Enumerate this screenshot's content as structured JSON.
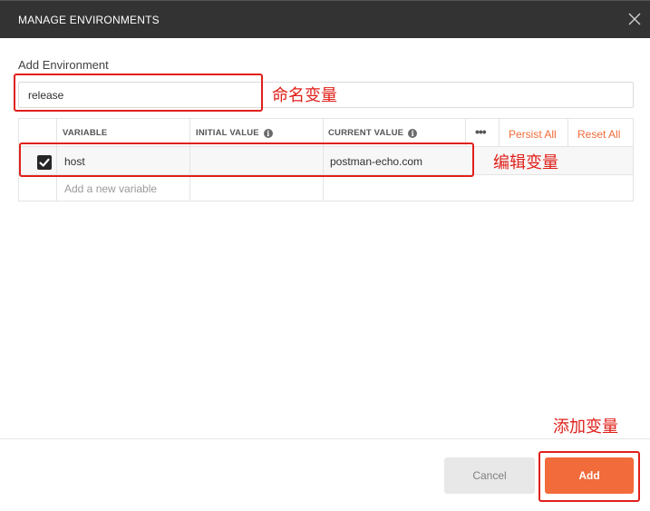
{
  "window": {
    "title": "MANAGE ENVIRONMENTS"
  },
  "form": {
    "section_label": "Add Environment",
    "env_name_value": "release"
  },
  "table": {
    "columns": {
      "variable": "VARIABLE",
      "initial_value": "INITIAL VALUE",
      "current_value": "CURRENT VALUE"
    },
    "more_icon": "•••",
    "persist_all": "Persist All",
    "reset_all": "Reset All",
    "rows": [
      {
        "checked": true,
        "variable": "host",
        "initial_value": "",
        "current_value": "postman-echo.com"
      }
    ],
    "new_variable_placeholder": "Add a new variable"
  },
  "annotations": {
    "name_variable": "命名变量",
    "edit_variable": "编辑变量",
    "add_variable": "添加变量"
  },
  "footer": {
    "cancel_label": "Cancel",
    "add_label": "Add"
  },
  "colors": {
    "accent": "#f26b3a",
    "annotation": "#e0201a",
    "titlebar": "#333333"
  }
}
